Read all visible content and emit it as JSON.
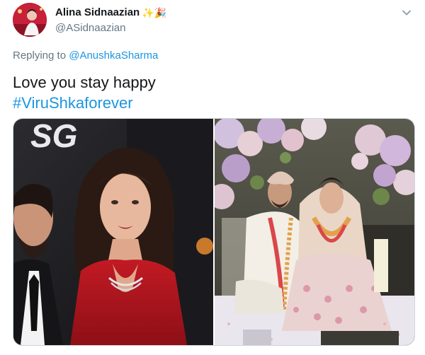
{
  "author": {
    "display_name": "Alina Sidnaazian",
    "name_emojis": "✨🎉",
    "handle": "@ASidnaazian"
  },
  "reply": {
    "prefix": "Replying to ",
    "mention": "@AnushkaSharma"
  },
  "tweet": {
    "text": "Love you stay happy",
    "hashtag": "#ViruShkaforever"
  },
  "media": {
    "photo_1_logo_text": "SG",
    "icons": {
      "caret": "chevron-down-icon"
    }
  },
  "colors": {
    "link": "#1b95e0",
    "muted": "#657786",
    "text": "#14171a",
    "border": "#ccd6dd"
  }
}
